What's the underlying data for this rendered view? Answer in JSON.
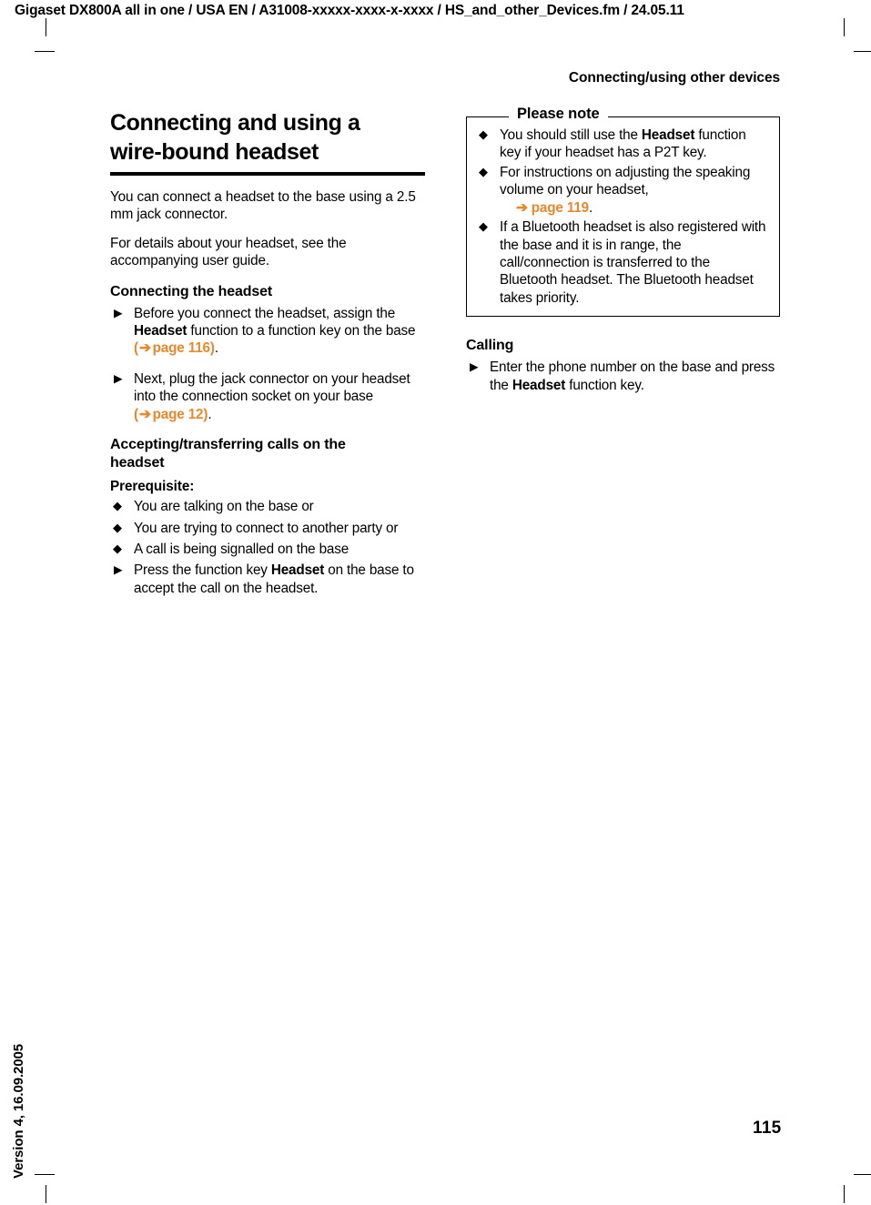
{
  "header": {
    "doc_info": "Gigaset DX800A all in one / USA EN / A31008-xxxxx-xxxx-x-xxxx / HS_and_other_Devices.fm / 24.05.11",
    "section_title": "Connecting/using other devices"
  },
  "sidebar": {
    "version": "Version 4, 16.09.2005"
  },
  "footer": {
    "page_number": "115"
  },
  "colors": {
    "link_orange": "#E8872B",
    "text_black": "#000000",
    "page_background": "#FFFFFF"
  },
  "left_column": {
    "chapter_title_line1": "Connecting and using a",
    "chapter_title_line2": "wire-bound headset",
    "intro_paragraph_1": "You can connect a headset to the base using a 2.5 mm jack connector.",
    "intro_paragraph_2": "For details about your headset, see the accompanying user guide.",
    "heading_connecting": "Connecting the headset",
    "steps_connecting": [
      {
        "marker": "triangle-right-icon",
        "text_before_bold": "Before you connect the headset, assign the ",
        "bold": "Headset",
        "text_after_bold": " function to a function key on the base ",
        "link_open": "(",
        "link_arrow": "➔",
        "link_label": "page 116",
        "link_close": ")",
        "trailing": "."
      },
      {
        "marker": "triangle-right-icon",
        "text_before_bold": "Next, plug the jack connector on your headset into the connection socket on your base ",
        "bold": "",
        "text_after_bold": "",
        "link_open": "(",
        "link_arrow": "➔",
        "link_label": "page 12",
        "link_close": ")",
        "trailing": "."
      }
    ],
    "heading_accepting_line1": "Accepting/transferring calls on the",
    "heading_accepting_line2": "headset",
    "prerequisite_label": "Prerequisite:",
    "prerequisite_items": [
      {
        "marker": "diamond-icon",
        "text": "You are talking on the base or"
      },
      {
        "marker": "diamond-icon",
        "text": "You are trying to connect to another party or"
      },
      {
        "marker": "diamond-icon",
        "text": "A call is being signalled on the base"
      }
    ],
    "accept_step": {
      "marker": "triangle-right-icon",
      "text_before_bold": "Press the function key ",
      "bold": "Headset",
      "text_after_bold": " on the base to accept the call on the headset."
    }
  },
  "right_column": {
    "note_box": {
      "title": "Please note",
      "items": [
        {
          "marker": "diamond-icon",
          "text_before_bold": "You should still use the ",
          "bold": "Headset",
          "text_after_bold": " function key if your headset has a P2T key."
        },
        {
          "marker": "diamond-icon",
          "text_before_bold": "For instructions on adjusting the speaking volume on your headset,",
          "bold": "",
          "text_after_bold": "",
          "link_arrow": "➔",
          "link_label": "page 119",
          "trailing": "."
        },
        {
          "marker": "diamond-icon",
          "text_before_bold": "If a Bluetooth headset is also registered with the base and it is in range, the call/connection is transferred to the Bluetooth headset. The Bluetooth headset takes priority.",
          "bold": "",
          "text_after_bold": ""
        }
      ]
    },
    "heading_calling": "Calling",
    "calling_step": {
      "marker": "triangle-right-icon",
      "text_before_bold": "Enter the phone number on the base and press the ",
      "bold": "Headset",
      "text_after_bold": " function key."
    }
  },
  "icons": {
    "diamond": "◆",
    "triangle_right": "▶",
    "arrow_right": "➔"
  }
}
